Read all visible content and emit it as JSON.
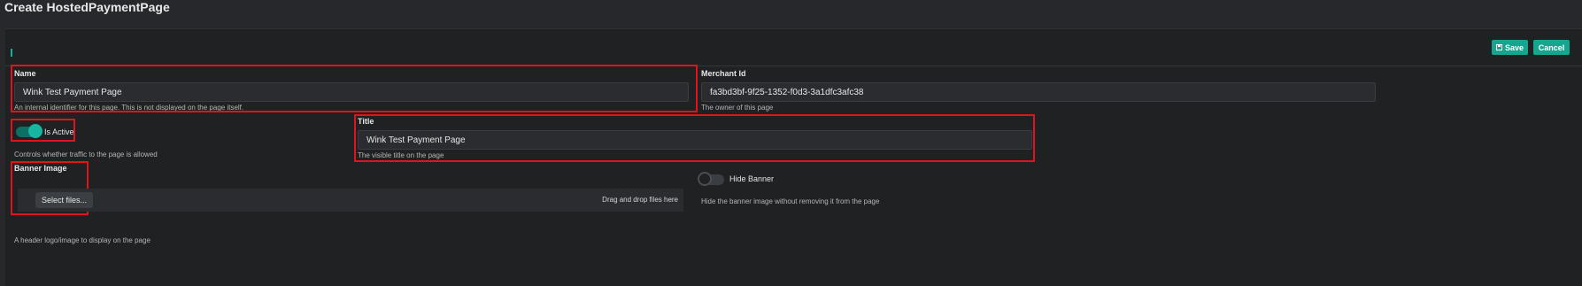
{
  "page": {
    "title": "Create HostedPaymentPage"
  },
  "toolbar": {
    "save_label": "Save",
    "cancel_label": "Cancel",
    "save_icon": "floppy-disk-icon"
  },
  "form": {
    "name": {
      "label": "Name",
      "value": "Wink Test Payment Page",
      "help": "An internal identifier for this page. This is not displayed on the page itself."
    },
    "merchant_id": {
      "label": "Merchant Id",
      "value": "fa3bd3bf-9f25-1352-f0d3-3a1dfc3afc38",
      "help": "The owner of this page"
    },
    "is_active": {
      "label": "Is Active",
      "checked": true,
      "help": "Controls whether traffic to the page is allowed"
    },
    "title": {
      "label": "Title",
      "value": "Wink Test Payment Page",
      "help": "The visible title on the page"
    },
    "banner_image": {
      "label": "Banner Image",
      "select_label": "Select files...",
      "drop_hint": "Drag and drop files here",
      "help": "A header logo/image to display on the page"
    },
    "hide_banner": {
      "label": "Hide Banner",
      "checked": false,
      "help": "Hide the banner image without removing it from the page"
    }
  },
  "colors": {
    "accent": "#17a58f",
    "highlight": "#e0141c",
    "background": "#1f2123"
  }
}
